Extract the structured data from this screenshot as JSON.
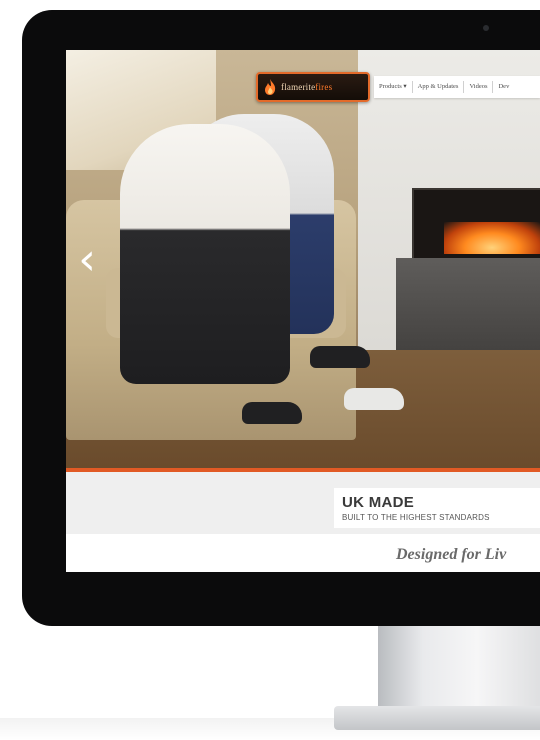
{
  "header": {
    "logo_brand": "flamerite",
    "logo_brand_accent": "fires",
    "nav": [
      {
        "label": "Products ▾"
      },
      {
        "label": "App & Updates"
      },
      {
        "label": "Videos"
      },
      {
        "label": "Dev"
      }
    ]
  },
  "hero": {
    "prev_arrow": "‹"
  },
  "usp": {
    "title": "UK MADE",
    "subtitle": "BUILT TO THE HIGHEST STANDARDS"
  },
  "tagline": "Designed for Liv",
  "colors": {
    "accent": "#e15a25",
    "bezel": "#0b0b0c",
    "band": "#efefef"
  }
}
